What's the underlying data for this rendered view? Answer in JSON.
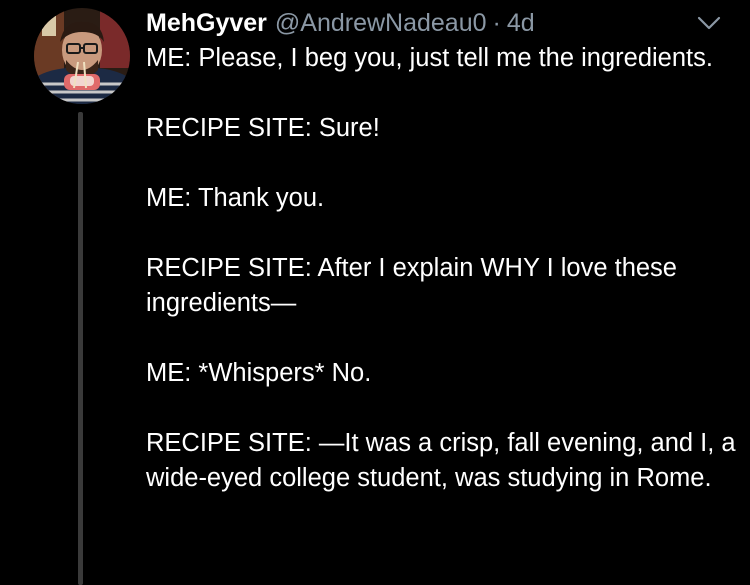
{
  "tweet": {
    "display_name": "MehGyver",
    "handle": "@AndrewNadeau0",
    "separator": "·",
    "timestamp": "4d",
    "paragraphs": [
      "ME: Please, I beg you, just tell me the ingredients.",
      "RECIPE SITE: Sure!",
      "ME: Thank you.",
      "RECIPE SITE: After I explain WHY I love these ingredients—",
      "ME: *Whispers* No.",
      "RECIPE SITE: —It was a crisp, fall evening, and I, a wide-eyed college student, was studying in Rome."
    ]
  },
  "icons": {
    "caret": "chevron-down-icon",
    "avatar": "avatar"
  },
  "colors": {
    "background": "#000000",
    "text_primary": "#ffffff",
    "text_secondary": "#8b98a5",
    "thread_line": "#3a3a3a"
  }
}
